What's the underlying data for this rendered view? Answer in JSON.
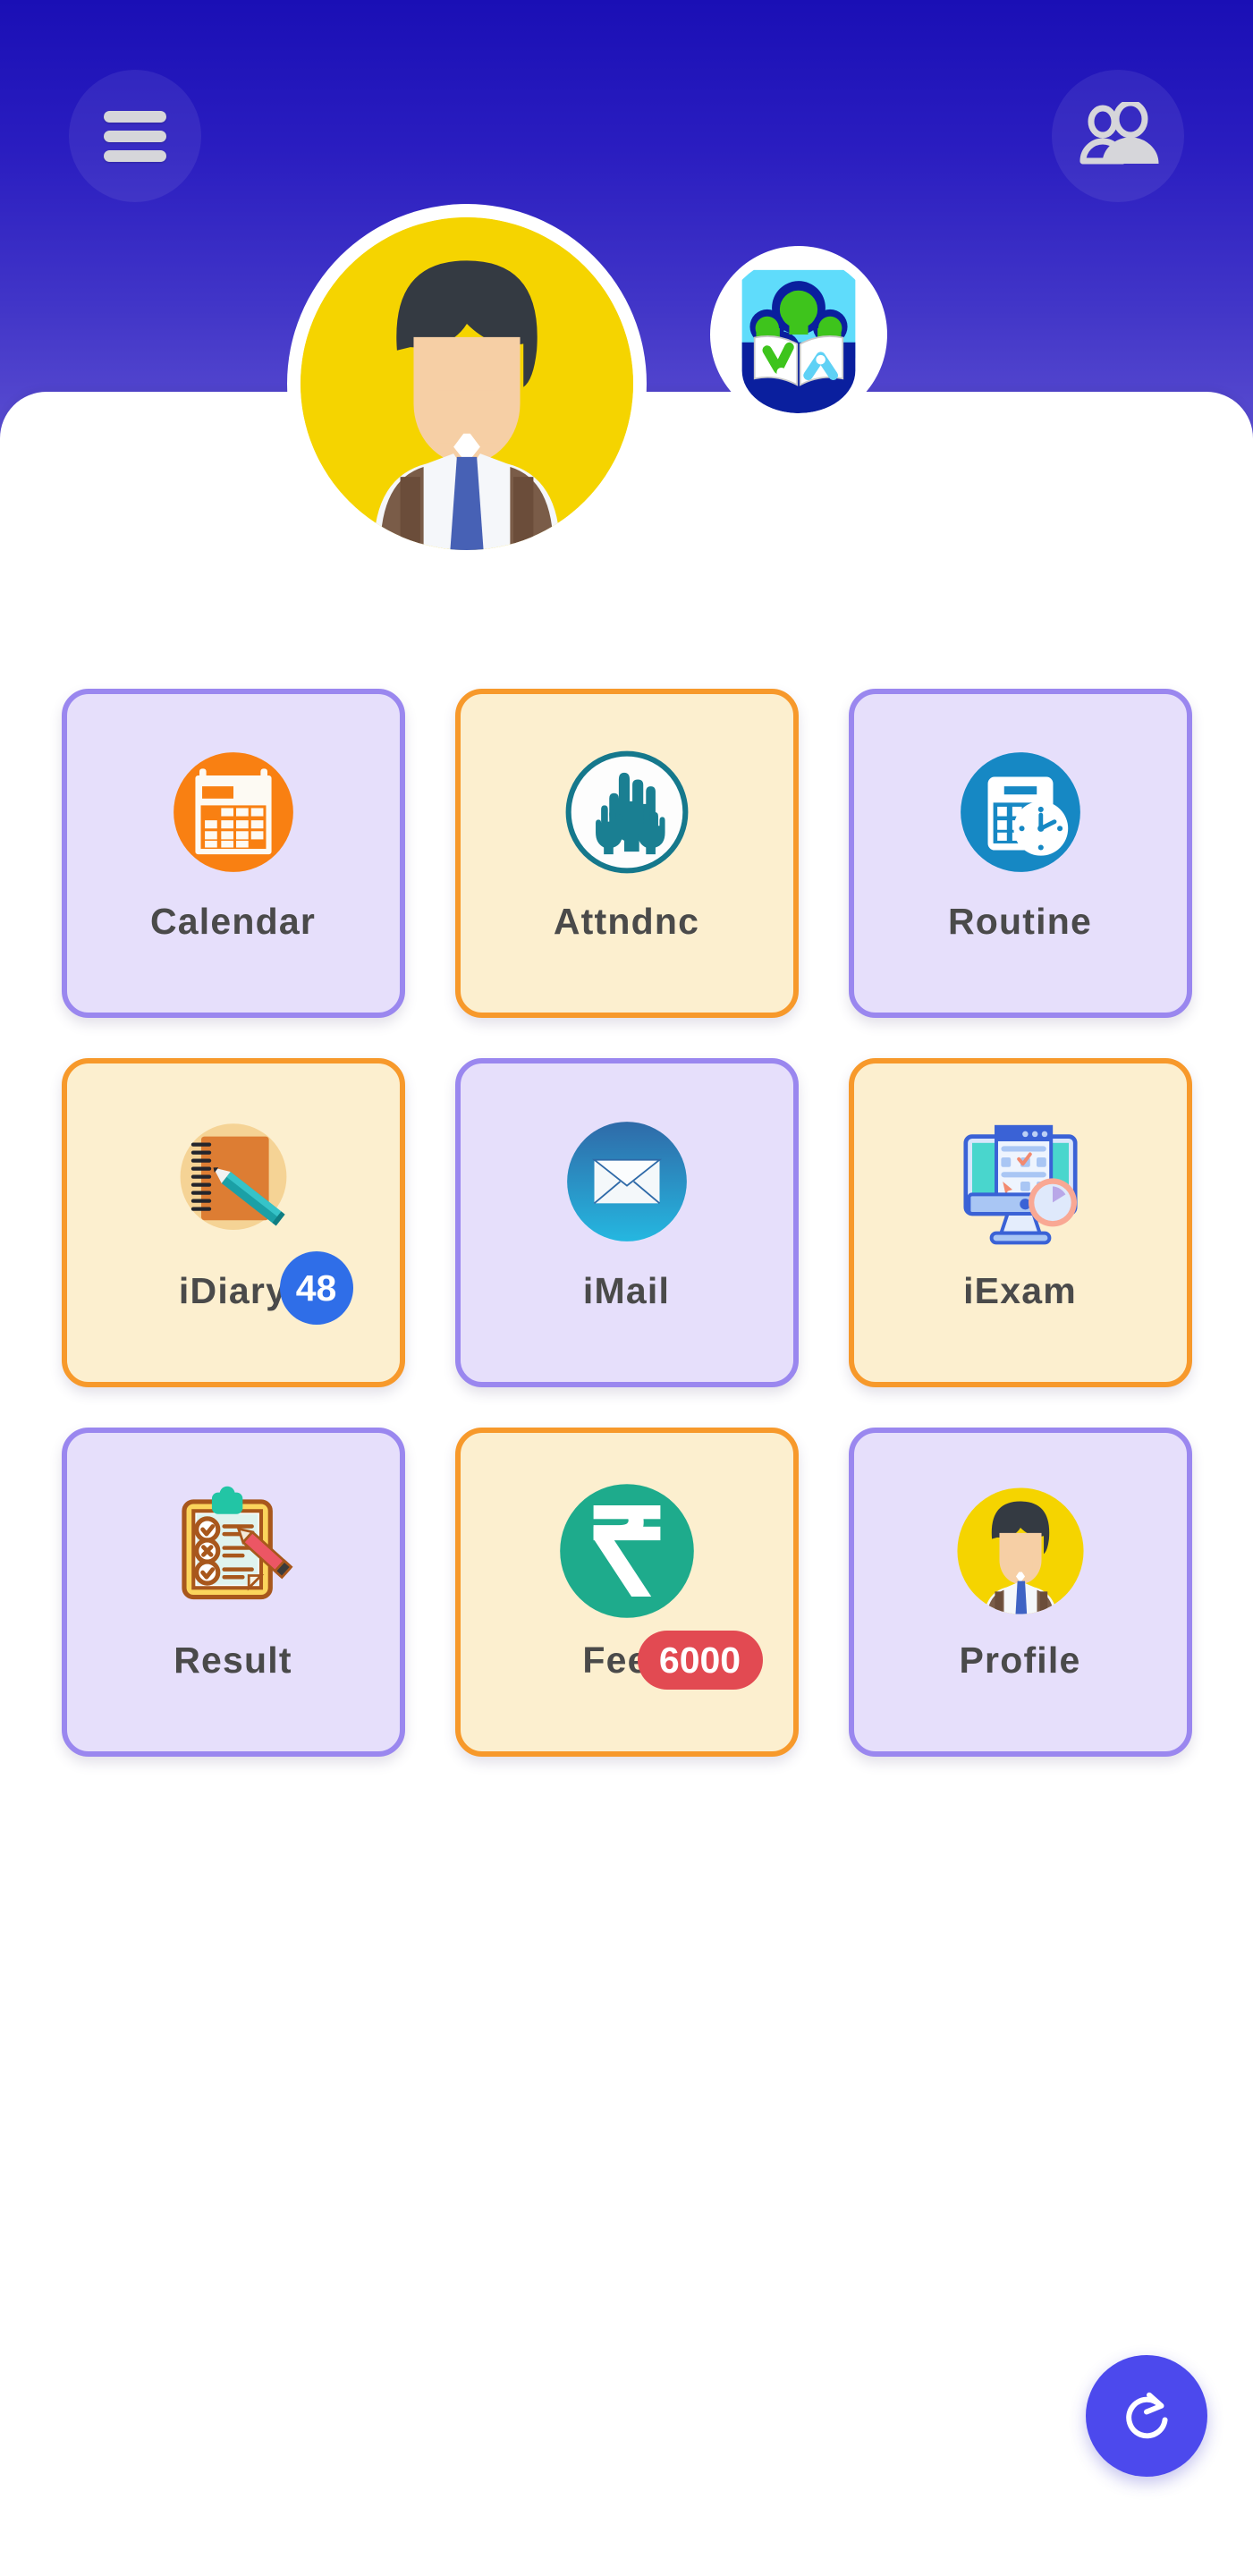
{
  "header": {
    "menu_icon": "hamburger-menu-icon",
    "users_icon": "people-group-icon",
    "avatar_icon": "student-avatar",
    "logo_icon": "school-crest-logo",
    "background_gradient_start": "#1a0fb5",
    "background_gradient_end": "#6b5fd6"
  },
  "grid": {
    "tiles": [
      {
        "label": "Calendar",
        "icon": "calendar-icon",
        "theme": "purple",
        "badge": null
      },
      {
        "label": "Attndnc",
        "icon": "raised-hands-icon",
        "theme": "cream",
        "badge": null
      },
      {
        "label": "Routine",
        "icon": "schedule-clock-icon",
        "theme": "purple",
        "badge": null
      },
      {
        "label": "iDiary",
        "icon": "notebook-pencil-icon",
        "theme": "cream",
        "badge": "48",
        "badge_type": "count",
        "badge_color": "#2f6ee8"
      },
      {
        "label": "iMail",
        "icon": "envelope-icon",
        "theme": "purple",
        "badge": null
      },
      {
        "label": "iExam",
        "icon": "monitor-exam-clock-icon",
        "theme": "cream",
        "badge": null
      },
      {
        "label": "Result",
        "icon": "clipboard-checklist-icon",
        "theme": "purple",
        "badge": null
      },
      {
        "label": "Fees",
        "icon": "rupee-coin-icon",
        "theme": "cream",
        "badge": "6000",
        "badge_type": "amount",
        "badge_color": "#e24a52"
      },
      {
        "label": "Profile",
        "icon": "user-profile-icon",
        "theme": "purple",
        "badge": null
      }
    ]
  },
  "fab": {
    "icon": "refresh-rotate-icon",
    "color": "#4c49ed"
  },
  "theme": {
    "tile_purple_bg": "#e6dffb",
    "tile_purple_border": "#9a87ef",
    "tile_cream_bg": "#fcefcf",
    "tile_cream_border": "#f7992b",
    "label_color": "#4a4a4a"
  }
}
